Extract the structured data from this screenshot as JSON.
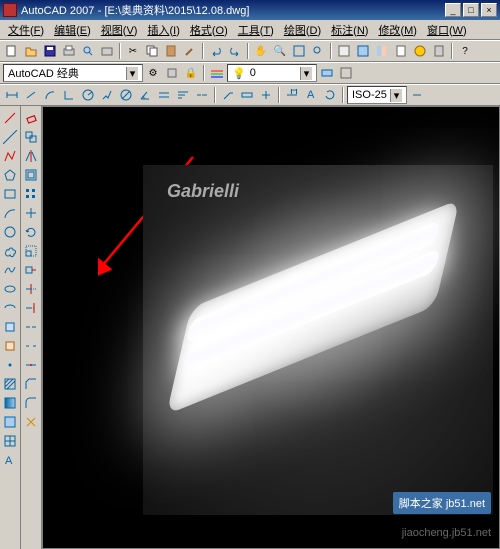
{
  "titlebar": {
    "app": "AutoCAD 2007",
    "doc": "[E:\\奥典资料\\2015\\12.08.dwg]"
  },
  "menu": {
    "file": "文件",
    "file_u": "F",
    "edit": "编辑",
    "edit_u": "E",
    "view": "视图",
    "view_u": "V",
    "insert": "插入",
    "insert_u": "I",
    "format": "格式",
    "format_u": "O",
    "tools": "工具",
    "tools_u": "T",
    "draw": "绘图",
    "draw_u": "D",
    "dim": "标注",
    "dim_u": "N",
    "modify": "修改",
    "modify_u": "M",
    "window": "窗口",
    "window_u": "W"
  },
  "workspace": {
    "label": "AutoCAD 经典"
  },
  "layer": {
    "current": "0"
  },
  "dimstyle": {
    "current": "ISO-25"
  },
  "canvas": {
    "brand": "Gabrielli"
  },
  "wm": {
    "site": "脚本之家 jb51.net",
    "url": "jiaocheng.jb51.net"
  }
}
